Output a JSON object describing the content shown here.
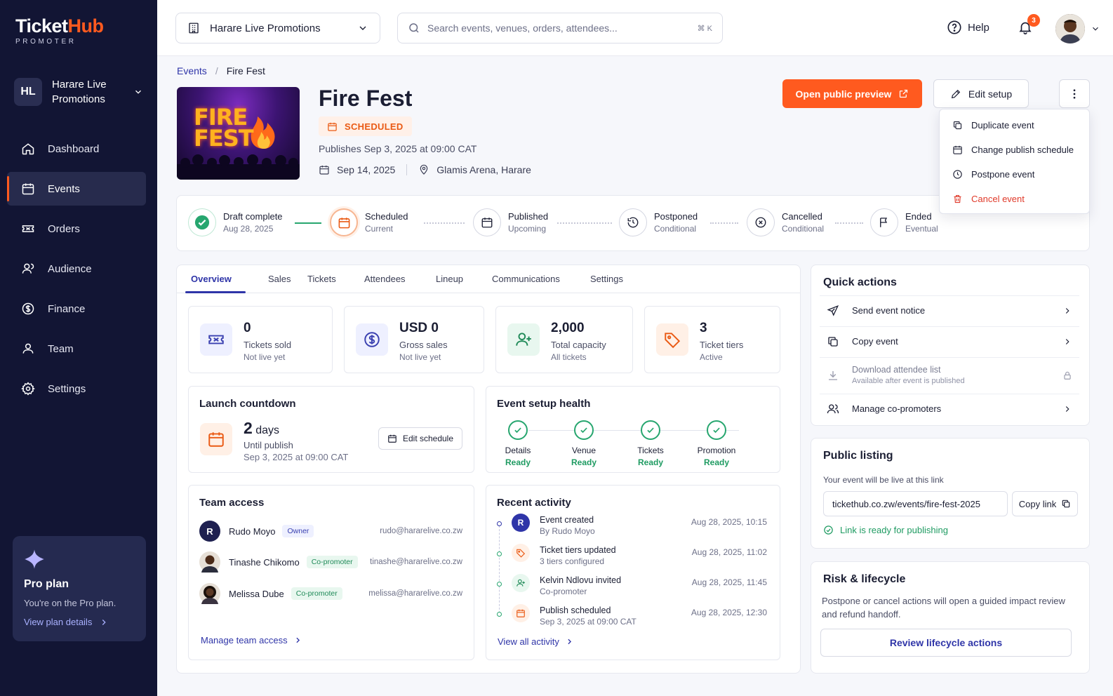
{
  "brand": {
    "name_part1": "Ticket",
    "name_part2": "Hub",
    "tagline": "PROMOTER"
  },
  "sidebar": {
    "org_initials": "HL",
    "org_name": "Harare Live Promotions",
    "items": [
      {
        "label": "Dashboard",
        "icon": "home-icon"
      },
      {
        "label": "Events",
        "icon": "calendar-icon",
        "active": true
      },
      {
        "label": "Orders",
        "icon": "ticket-icon"
      },
      {
        "label": "Audience",
        "icon": "user-icon"
      },
      {
        "label": "Finance",
        "icon": "dollar-icon"
      },
      {
        "label": "Team",
        "icon": "team-icon"
      },
      {
        "label": "Settings",
        "icon": "gear-icon"
      }
    ],
    "plan": {
      "title": "Pro plan",
      "desc": "You're on the Pro plan.",
      "link": "View plan details"
    }
  },
  "topbar": {
    "org_selector": "Harare Live Promotions",
    "search_placeholder": "Search events, venues, orders, attendees...",
    "search_shortcut": "⌘ K",
    "help": "Help",
    "notification_count": "3"
  },
  "breadcrumb": {
    "root": "Events",
    "sep": "/",
    "current": "Fire Fest"
  },
  "event": {
    "poster_text_line1": "FIRE",
    "poster_text_line2": "FEST",
    "title": "Fire Fest",
    "status": "SCHEDULED",
    "publishes": "Publishes Sep 3, 2025 at 09:00 CAT",
    "date": "Sep 14, 2025",
    "venue": "Glamis Arena, Harare"
  },
  "actions": {
    "preview": "Open public preview",
    "edit": "Edit setup",
    "menu": [
      {
        "label": "Duplicate event",
        "icon": "copy-icon"
      },
      {
        "label": "Change publish schedule",
        "icon": "calendar-icon"
      },
      {
        "label": "Postpone event",
        "icon": "clock-icon"
      },
      {
        "label": "Cancel event",
        "icon": "trash-icon",
        "danger": true
      }
    ]
  },
  "lifecycle": [
    {
      "name": "Draft complete",
      "sub": "Aug 28, 2025",
      "state": "done"
    },
    {
      "name": "Scheduled",
      "sub": "Current",
      "state": "current"
    },
    {
      "name": "Published",
      "sub": "Upcoming",
      "state": "todo"
    },
    {
      "name": "Postponed",
      "sub": "Conditional",
      "state": "todo"
    },
    {
      "name": "Cancelled",
      "sub": "Conditional",
      "state": "todo"
    },
    {
      "name": "Ended",
      "sub": "Eventual",
      "state": "todo"
    }
  ],
  "tabs": [
    "Overview",
    "Sales",
    "Tickets",
    "Attendees",
    "Lineup",
    "Communications",
    "Settings"
  ],
  "stats": [
    {
      "value": "0",
      "label": "Tickets sold",
      "sub": "Not live yet"
    },
    {
      "value": "USD 0",
      "label": "Gross sales",
      "sub": "Not live yet"
    },
    {
      "value": "2,000",
      "label": "Total capacity",
      "sub": "All tickets"
    },
    {
      "value": "3",
      "label": "Ticket tiers",
      "sub": "Active"
    }
  ],
  "countdown": {
    "title": "Launch countdown",
    "days_num": "2",
    "days_unit": "days",
    "until": "Until publish",
    "date": "Sep 3, 2025 at 09:00 CAT",
    "button": "Edit schedule"
  },
  "health": {
    "title": "Event setup health",
    "items": [
      {
        "name": "Details",
        "status": "Ready"
      },
      {
        "name": "Venue",
        "status": "Ready"
      },
      {
        "name": "Tickets",
        "status": "Ready"
      },
      {
        "name": "Promotion",
        "status": "Ready"
      }
    ]
  },
  "team": {
    "title": "Team access",
    "members": [
      {
        "initial": "R",
        "name": "Rudo Moyo",
        "role": "Owner",
        "email": "rudo@hararelive.co.zw"
      },
      {
        "initial": "",
        "name": "Tinashe Chikomo",
        "role": "Co-promoter",
        "email": "tinashe@hararelive.co.zw"
      },
      {
        "initial": "",
        "name": "Melissa Dube",
        "role": "Co-promoter",
        "email": "melissa@hararelive.co.zw"
      }
    ],
    "link": "Manage team access"
  },
  "activity": {
    "title": "Recent activity",
    "items": [
      {
        "icon_text": "R",
        "title": "Event created",
        "sub": "By Rudo Moyo",
        "time": "Aug 28, 2025, 10:15"
      },
      {
        "icon_text": "",
        "title": "Ticket tiers updated",
        "sub": "3 tiers configured",
        "time": "Aug 28, 2025, 11:02"
      },
      {
        "icon_text": "",
        "title": "Kelvin Ndlovu invited",
        "sub": "Co-promoter",
        "time": "Aug 28, 2025, 11:45"
      },
      {
        "icon_text": "",
        "title": "Publish scheduled",
        "sub": "Sep 3, 2025 at 09:00 CAT",
        "time": "Aug 28, 2025, 12:30"
      }
    ],
    "link": "View all activity"
  },
  "quick_actions": {
    "title": "Quick actions",
    "items": [
      {
        "label": "Send event notice"
      },
      {
        "label": "Copy event"
      },
      {
        "label": "Download attendee list",
        "sub": "Available after event is published",
        "disabled": true
      },
      {
        "label": "Manage co-promoters"
      }
    ]
  },
  "public_listing": {
    "title": "Public listing",
    "desc": "Your event will be live at this link",
    "url": "tickethub.co.zw/events/fire-fest-2025",
    "copy": "Copy link",
    "status": "Link is ready for publishing"
  },
  "risk": {
    "title": "Risk & lifecycle",
    "desc": "Postpone or cancel actions will open a guided impact review and refund handoff.",
    "button": "Review lifecycle actions"
  },
  "colors": {
    "accent": "#ff5a1f",
    "primary": "#2f35a8",
    "sidebar": "#121534",
    "success": "#27a66f",
    "danger": "#e03a2a"
  }
}
